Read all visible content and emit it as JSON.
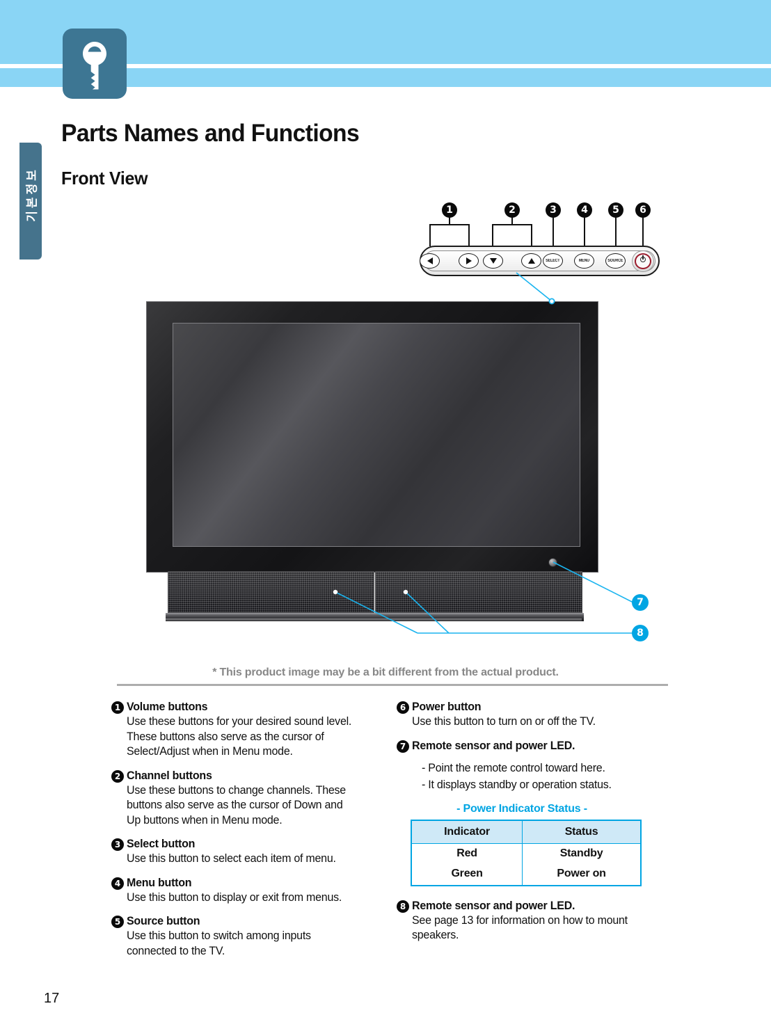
{
  "header": {
    "icon": "key-icon",
    "band_color": "#8ad5f5",
    "icon_bg_color": "#3d7693"
  },
  "side_tab": {
    "label": "기본정보"
  },
  "page_title": "Parts Names and Functions",
  "section_title": "Front View",
  "control_panel": {
    "callouts": [
      "1",
      "2",
      "3",
      "4",
      "5",
      "6"
    ],
    "buttons": [
      {
        "name": "left-arrow-button",
        "label": "◀"
      },
      {
        "name": "right-arrow-button",
        "label": "▶"
      },
      {
        "name": "down-arrow-button",
        "label": "▼"
      },
      {
        "name": "up-arrow-button",
        "label": "▲"
      },
      {
        "name": "select-button",
        "label": "SELECT"
      },
      {
        "name": "menu-button",
        "label": "MENU"
      },
      {
        "name": "source-button",
        "label": "SOURCE"
      },
      {
        "name": "power-button",
        "label": "power"
      }
    ]
  },
  "tv_callouts": [
    "7",
    "8"
  ],
  "footnote": "* This product image may be a bit different from the actual product.",
  "legend_left": [
    {
      "num": "1",
      "title": "Volume buttons",
      "lines": [
        "Use these buttons for your desired sound level.",
        "These buttons also serve as the cursor of",
        "Select/Adjust when in Menu mode."
      ]
    },
    {
      "num": "2",
      "title": "Channel buttons",
      "lines": [
        "Use these buttons to change channels. These",
        "buttons also serve as the cursor of Down and",
        "Up buttons when in Menu mode."
      ]
    },
    {
      "num": "3",
      "title": "Select button",
      "lines": [
        "Use this button to select each item of menu."
      ]
    },
    {
      "num": "4",
      "title": "Menu button",
      "lines": [
        "Use this button to display or exit from menus."
      ]
    },
    {
      "num": "5",
      "title": "Source button",
      "lines": [
        "Use this button to switch among inputs",
        "connected to the TV."
      ]
    }
  ],
  "legend_right": [
    {
      "num": "6",
      "title": "Power button",
      "lines": [
        "Use this button to turn on or off the TV."
      ]
    },
    {
      "num": "7",
      "title": "Remote sensor and power LED.",
      "sub_lines": [
        "- Point the remote control toward here.",
        "- It displays standby or operation status."
      ]
    },
    {
      "num": "8",
      "title": "Remote sensor and power LED.",
      "lines": [
        "See page 13 for information on how to mount",
        "speakers."
      ]
    }
  ],
  "status_table": {
    "title": "- Power Indicator Status -",
    "headers": [
      "Indicator",
      "Status"
    ],
    "rows": [
      [
        "Red",
        "Standby"
      ],
      [
        "Green",
        "Power on"
      ]
    ],
    "border_color": "#00a5e3",
    "header_bg_color": "#cfe9f7"
  },
  "page_number": "17"
}
